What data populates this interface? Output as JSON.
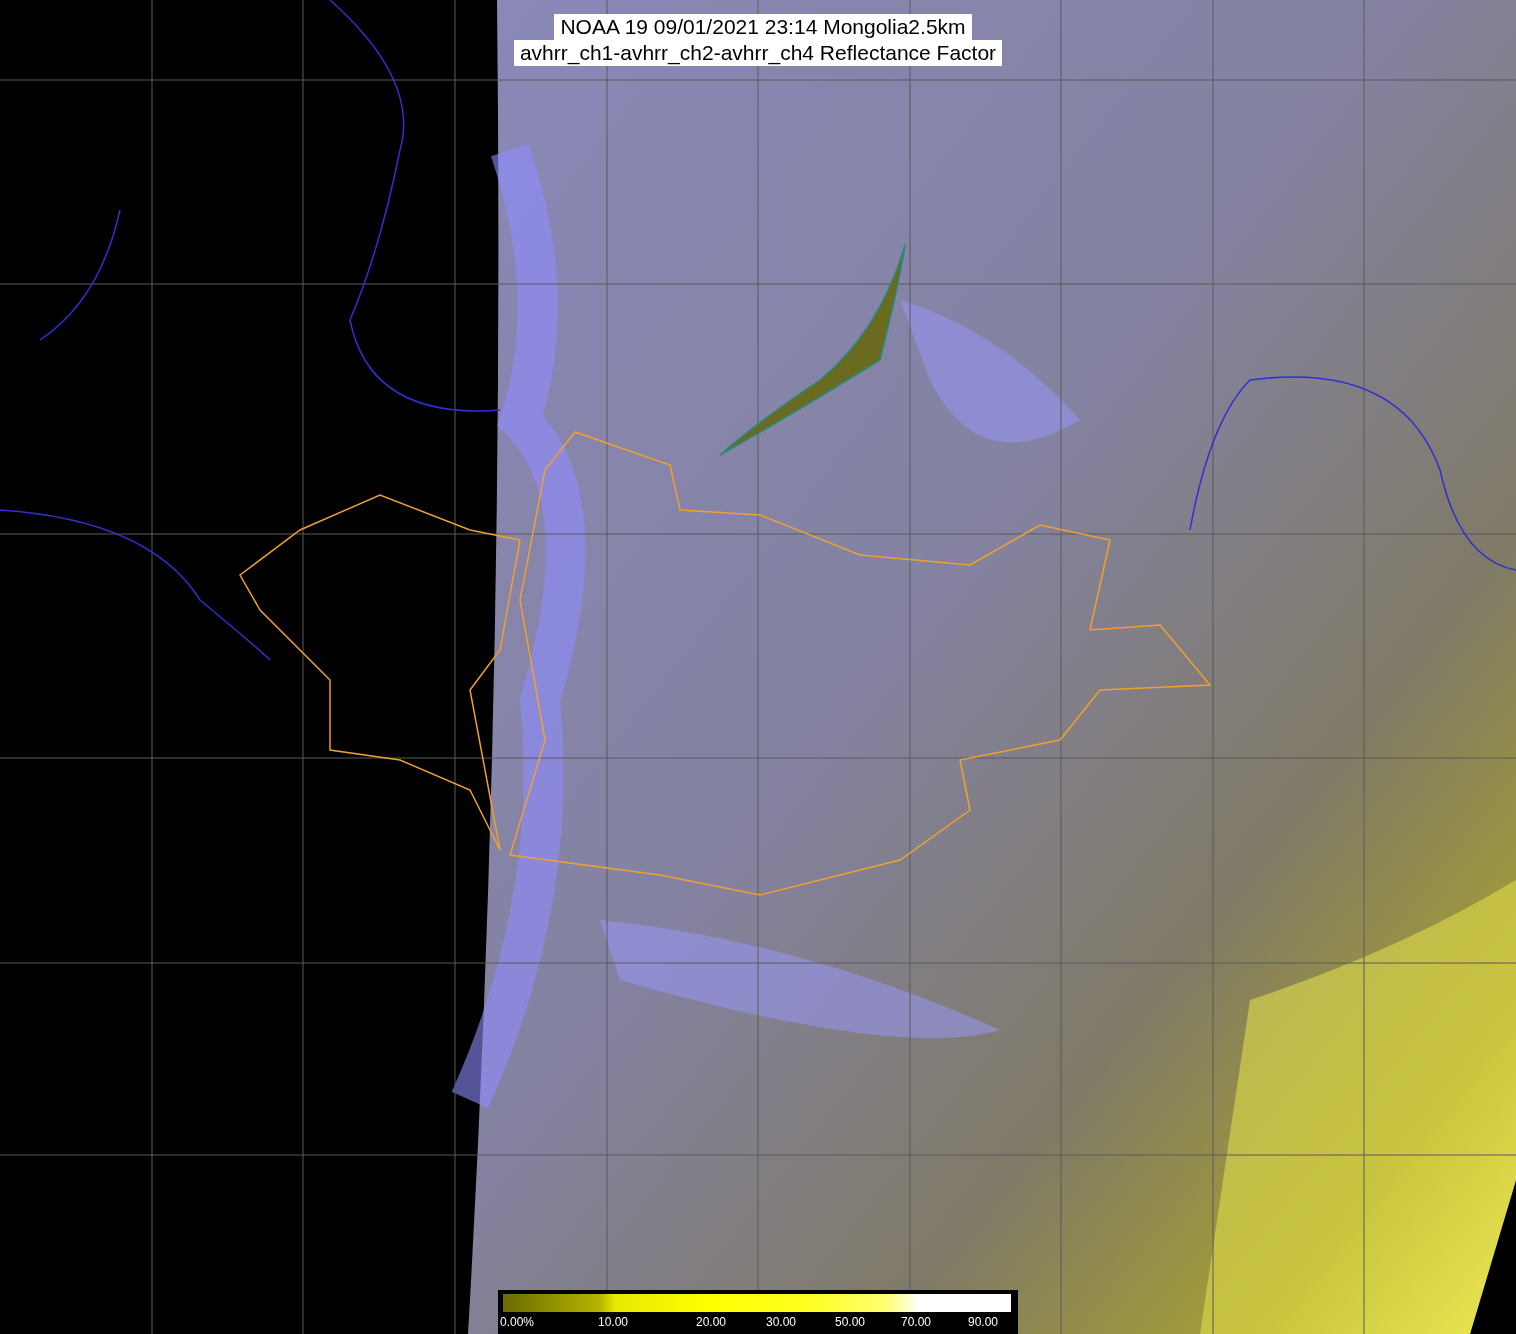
{
  "title": {
    "line_1": "NOAA 19 09/01/2021 23:14 Mongolia2.5km",
    "line_2": "avhrr_ch1-avhrr_ch2-avhrr_ch4 Reflectance Factor"
  },
  "colorbar": {
    "ticks": [
      "0.00%",
      "10.00",
      "20.00",
      "30.00",
      "50.00",
      "70.00",
      "90.00"
    ]
  }
}
